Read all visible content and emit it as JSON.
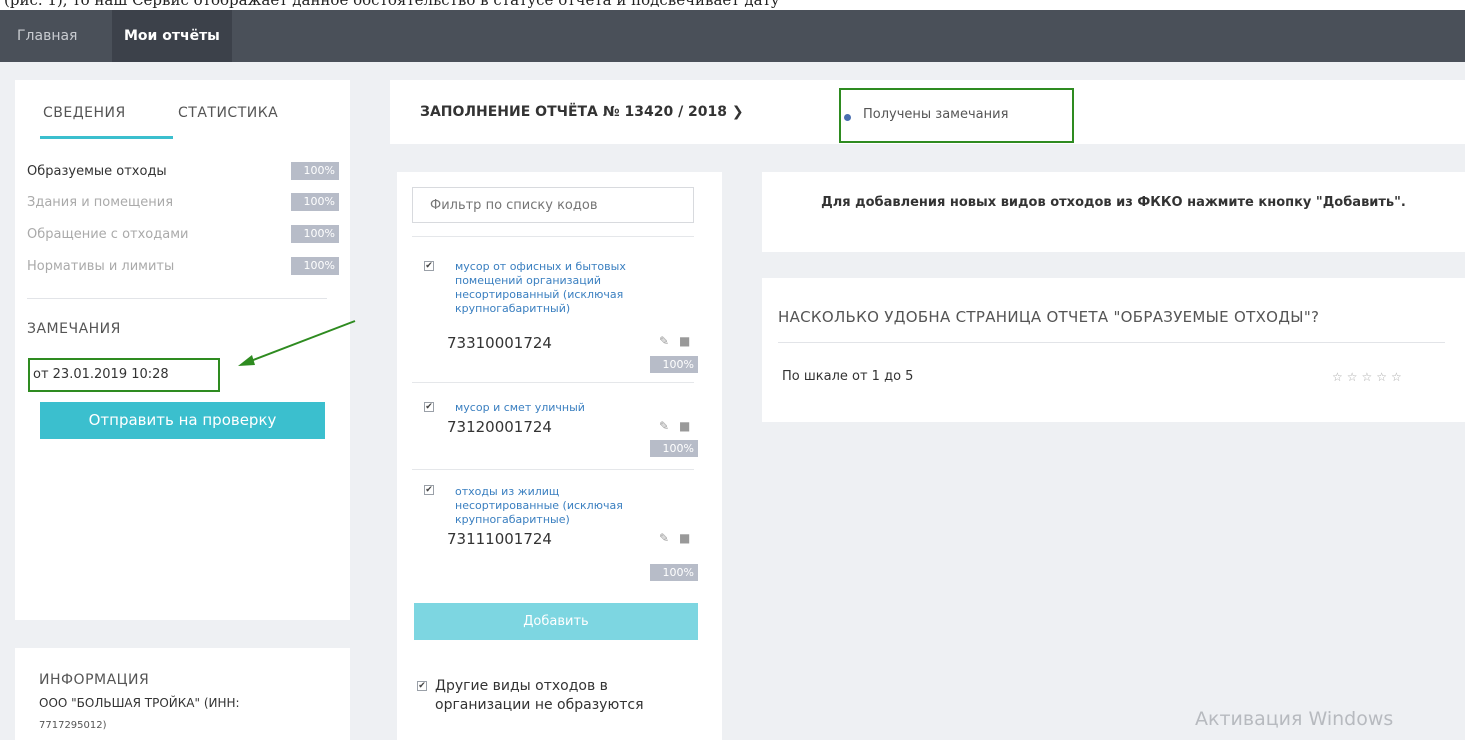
{
  "caption": "(рис. 1), то наш Сервис отображает данное обстоятельство в статусе отчёта и подсвечивает дату",
  "nav": {
    "home": "Главная",
    "my_reports": "Мои отчёты"
  },
  "sidebar": {
    "tabs": [
      "СВЕДЕНИЯ",
      "СТАТИСТИКА"
    ],
    "sections": [
      {
        "label": "Образуемые отходы",
        "badge": "100%"
      },
      {
        "label": "Здания и помещения",
        "badge": "100%"
      },
      {
        "label": "Обращение с отходами",
        "badge": "100%"
      },
      {
        "label": "Нормативы и лимиты",
        "badge": "100%"
      }
    ],
    "remarks_title": "ЗАМЕЧАНИЯ",
    "remark_date": "от 23.01.2019 10:28",
    "send_button": "Отправить на проверку"
  },
  "info": {
    "title": "ИНФОРМАЦИЯ",
    "org": "ООО \"БОЛЬШАЯ ТРОЙКА\" (ИНН:",
    "inn": "7717295012)"
  },
  "report": {
    "title": "ЗАПОЛНЕНИЕ ОТЧЁТА № 13420 / 2018",
    "status": "Получены замечания"
  },
  "codes": {
    "filter_placeholder": "Фильтр по списку кодов",
    "items": [
      {
        "name": "мусор от офисных и бытовых помещений организаций несортированный (исключая крупногабаритный)",
        "code": "73310001724",
        "badge": "100%"
      },
      {
        "name": "мусор и смет уличный",
        "code": "73120001724",
        "badge": "100%"
      },
      {
        "name": "отходы из жилищ несортированные (исключая крупногабаритные)",
        "code": "73111001724",
        "badge": "100%"
      }
    ],
    "add_button": "Добавить",
    "other_checkbox": "Другие виды отходов в организации не образуются"
  },
  "hint": "Для добавления новых видов отходов из ФККО нажмите кнопку \"Добавить\".",
  "survey": {
    "question": "НАСКОЛЬКО УДОБНА СТРАНИЦА ОТЧЕТА \"ОБРАЗУЕМЫЕ ОТХОДЫ\"?",
    "scale": "По шкале от 1 до 5",
    "stars": "☆☆☆☆☆"
  },
  "watermark": "Активация Windows",
  "colors": {
    "navbar": "#4a5059",
    "accent": "#3bbfce",
    "highlight": "#2e8b20",
    "badge": "#b7bcc8",
    "link": "#3a7fc0"
  }
}
